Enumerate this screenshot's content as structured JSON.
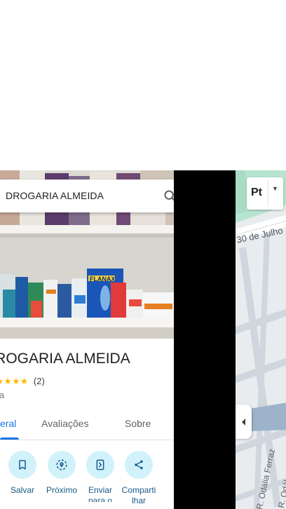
{
  "search": {
    "value": "DROGARIA ALMEIDA"
  },
  "place": {
    "title": "DROGARIA ALMEIDA",
    "title_visible": "GARIA ALMEIDA",
    "stars_glyph": "★★★★★",
    "rating_count": "(2)",
    "category": "ia"
  },
  "tabs": [
    {
      "label": "eral",
      "active": true
    },
    {
      "label": "Avaliações",
      "active": false
    },
    {
      "label": "Sobre",
      "active": false
    }
  ],
  "actions": [
    {
      "label": "Salvar",
      "icon": "bookmark-icon"
    },
    {
      "label": "Próximo",
      "icon": "nearby-icon"
    },
    {
      "label": "Enviar para o",
      "icon": "send-to-phone-icon"
    },
    {
      "label": "Compartilhar",
      "label_lines": "Comparti lhar",
      "icon": "share-icon"
    }
  ],
  "map": {
    "layer_button": "Pt",
    "streets": [
      "30 de Julho",
      "R. Odália Ferraz",
      "R. Odál"
    ]
  },
  "photo": {
    "product_label": "FLANAX"
  },
  "colors": {
    "accent": "#1a73e8",
    "action_bg": "#d1f1fb",
    "stars": "#fbbc04",
    "map_bg": "#e9ecef",
    "map_green": "#b7e4d0"
  }
}
